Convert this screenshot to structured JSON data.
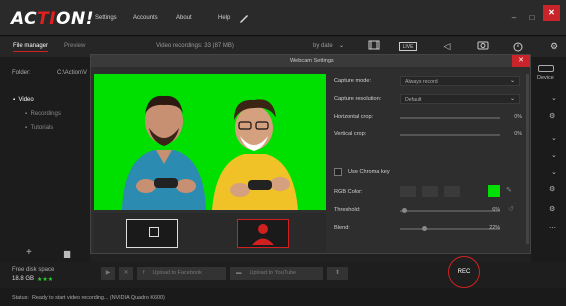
{
  "titlebar": {
    "brand_main": "AC",
    "brand_accent": "TI",
    "brand_end": "ON!",
    "menu": [
      "Settings",
      "Accounts",
      "About",
      "Help"
    ],
    "pen_icon": "pen-icon"
  },
  "toolbar": {
    "tabs": [
      "File manager",
      "Preview"
    ],
    "recordings_info": "Video recordings: 33 (87 MB)",
    "sort": "by date",
    "icons": [
      "film-icon",
      "live-icon",
      "speaker-icon",
      "camera-icon",
      "timer-icon",
      "gear-icon"
    ]
  },
  "sidebar": {
    "folder_label": "Folder:",
    "folder_value": "C:\\Action\\V",
    "tree": [
      {
        "label": "Video"
      },
      {
        "label": "Recordings"
      },
      {
        "label": "Tutorials"
      }
    ],
    "free_space_label": "Free disk space",
    "free_space_value": "18.8 GB"
  },
  "dialog": {
    "title": "Webcam Settings",
    "capture_mode_label": "Capture mode:",
    "capture_mode_value": "Always record",
    "capture_res_label": "Capture resolution:",
    "capture_res_value": "Default",
    "hcrop_label": "Horizontal crop:",
    "hcrop_value": "0%",
    "vcrop_label": "Vertical crop:",
    "vcrop_value": "0%",
    "chroma_label": "Use Chroma key",
    "rgb_label": "RGB Color:",
    "threshold_label": "Threshold:",
    "threshold_value": "6%",
    "blend_label": "Blend:",
    "blend_value": "22%",
    "accent_color": "#00e000"
  },
  "rightpanel": {
    "device_label": "Device"
  },
  "bottom": {
    "upload_facebook": "Upload to Facebook",
    "upload_youtube": "Upload to YouTube",
    "rec_label": "REC"
  },
  "status": {
    "label": "Status:",
    "text": "Ready to start video recording... (NVIDIA Quadro K600)"
  }
}
